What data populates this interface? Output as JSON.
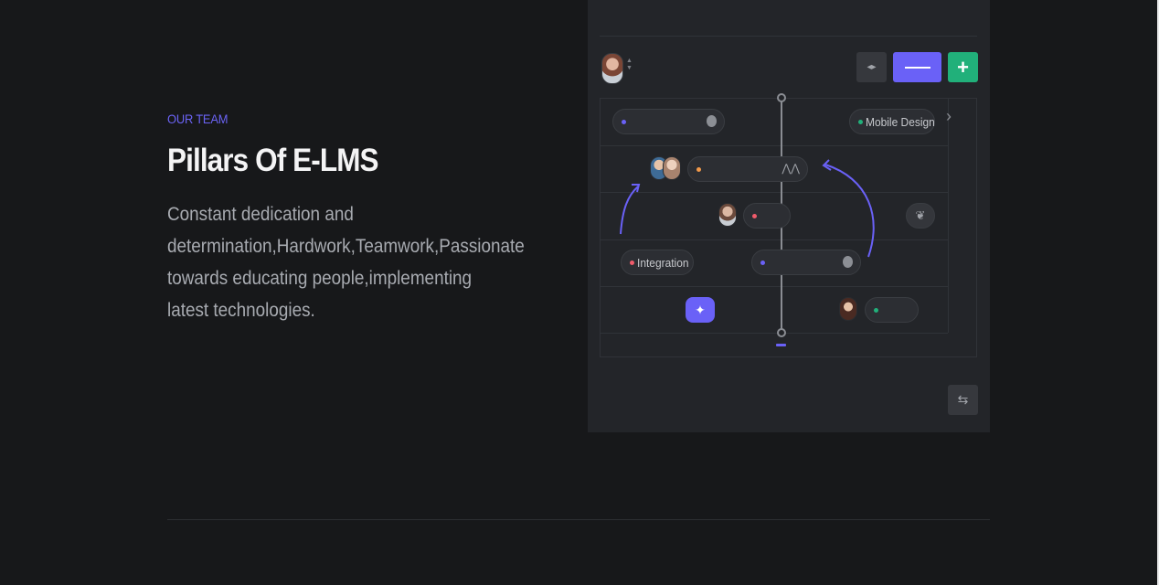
{
  "section": {
    "eyebrow": "OUR TEAM",
    "title": "Pillars Of E-LMS",
    "description": "Constant dedication and determination,Hardwork,Teamwork,Passionate towards educating people,implementing latest technologies."
  },
  "mockup": {
    "toolbar": {
      "code_icon": "code-icon",
      "line_icon": "minus-icon",
      "add_icon": "plus-icon",
      "add_label": "+"
    },
    "tags": {
      "mobile_design": "Mobile Design",
      "integration": "Integration"
    },
    "icons": {
      "sparkle": "sparkle-icon",
      "leaf": "leaf-icon",
      "swap": "swap-icon",
      "chevron": "chevron-right-icon"
    }
  },
  "colors": {
    "accent": "#6a61f7",
    "green": "#21b07a",
    "red": "#f05b6b",
    "orange": "#f39a4a",
    "background": "#17181a",
    "panel": "#232529"
  }
}
